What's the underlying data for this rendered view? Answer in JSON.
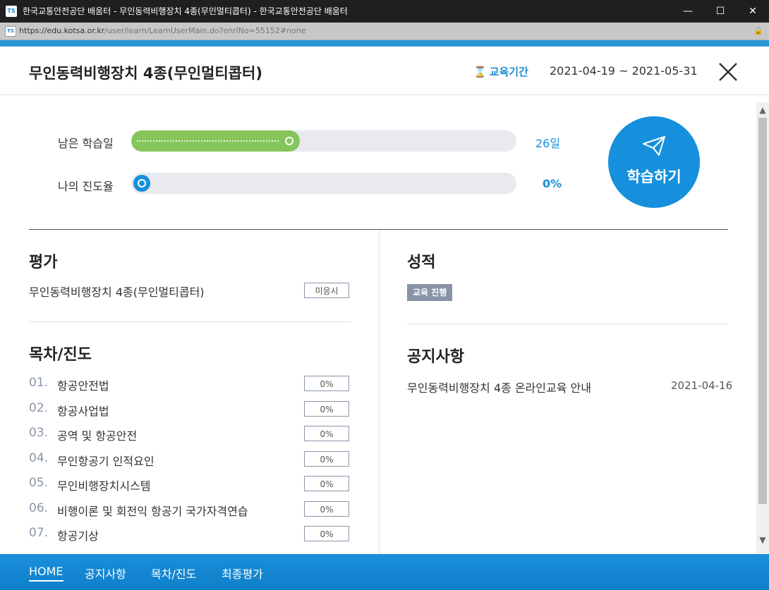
{
  "window": {
    "logo_text": "TS",
    "title": "한국교통안전공단 배움터 - 무인동력비행장치 4종(무인멀티콥터) - 한국교통안전공단 배움터",
    "url_host": "https://edu.kotsa.or.kr",
    "url_path": "/user/learn/LearnUserMain.do?enrlNo=55152#none"
  },
  "header": {
    "course_title": "무인동력비행장치 4종(무인멀티콥터)",
    "period_label": "교육기간",
    "period_value": "2021-04-19 ~ 2021-05-31"
  },
  "progress": {
    "remaining_label": "남은 학습일",
    "remaining_value": "26일",
    "remaining_fraction": 0.41,
    "my_progress_label": "나의 진도율",
    "my_progress_value": "0%",
    "my_progress_fraction": 0.0,
    "learn_button": "학습하기"
  },
  "evaluation": {
    "title": "평가",
    "item": "무인동력비행장치 4종(무인멀티콥터)",
    "status": "미응시"
  },
  "toc": {
    "title": "목차/진도",
    "items": [
      {
        "num": "01.",
        "label": "항공안전법",
        "progress": "0%"
      },
      {
        "num": "02.",
        "label": "항공사업법",
        "progress": "0%"
      },
      {
        "num": "03.",
        "label": "공역 및 항공안전",
        "progress": "0%"
      },
      {
        "num": "04.",
        "label": "무인항공기 인적요인",
        "progress": "0%"
      },
      {
        "num": "05.",
        "label": "무인비행장치시스템",
        "progress": "0%"
      },
      {
        "num": "06.",
        "label": "비행이론 및 회전익 항공기 국가자격연습",
        "progress": "0%"
      },
      {
        "num": "07.",
        "label": "항공기상",
        "progress": "0%"
      }
    ]
  },
  "grade": {
    "title": "성적",
    "badge": "교육 진행"
  },
  "notice": {
    "title": "공지사항",
    "item_title": "무인동력비행장치 4종 온라인교육 안내",
    "item_date": "2021-04-16"
  },
  "nav": {
    "items": [
      "HOME",
      "공지사항",
      "목차/진도",
      "최종평가"
    ],
    "active": "HOME"
  },
  "colors": {
    "accent": "#1b8ed6",
    "green": "#86c55a",
    "badge": "#8893a6"
  }
}
